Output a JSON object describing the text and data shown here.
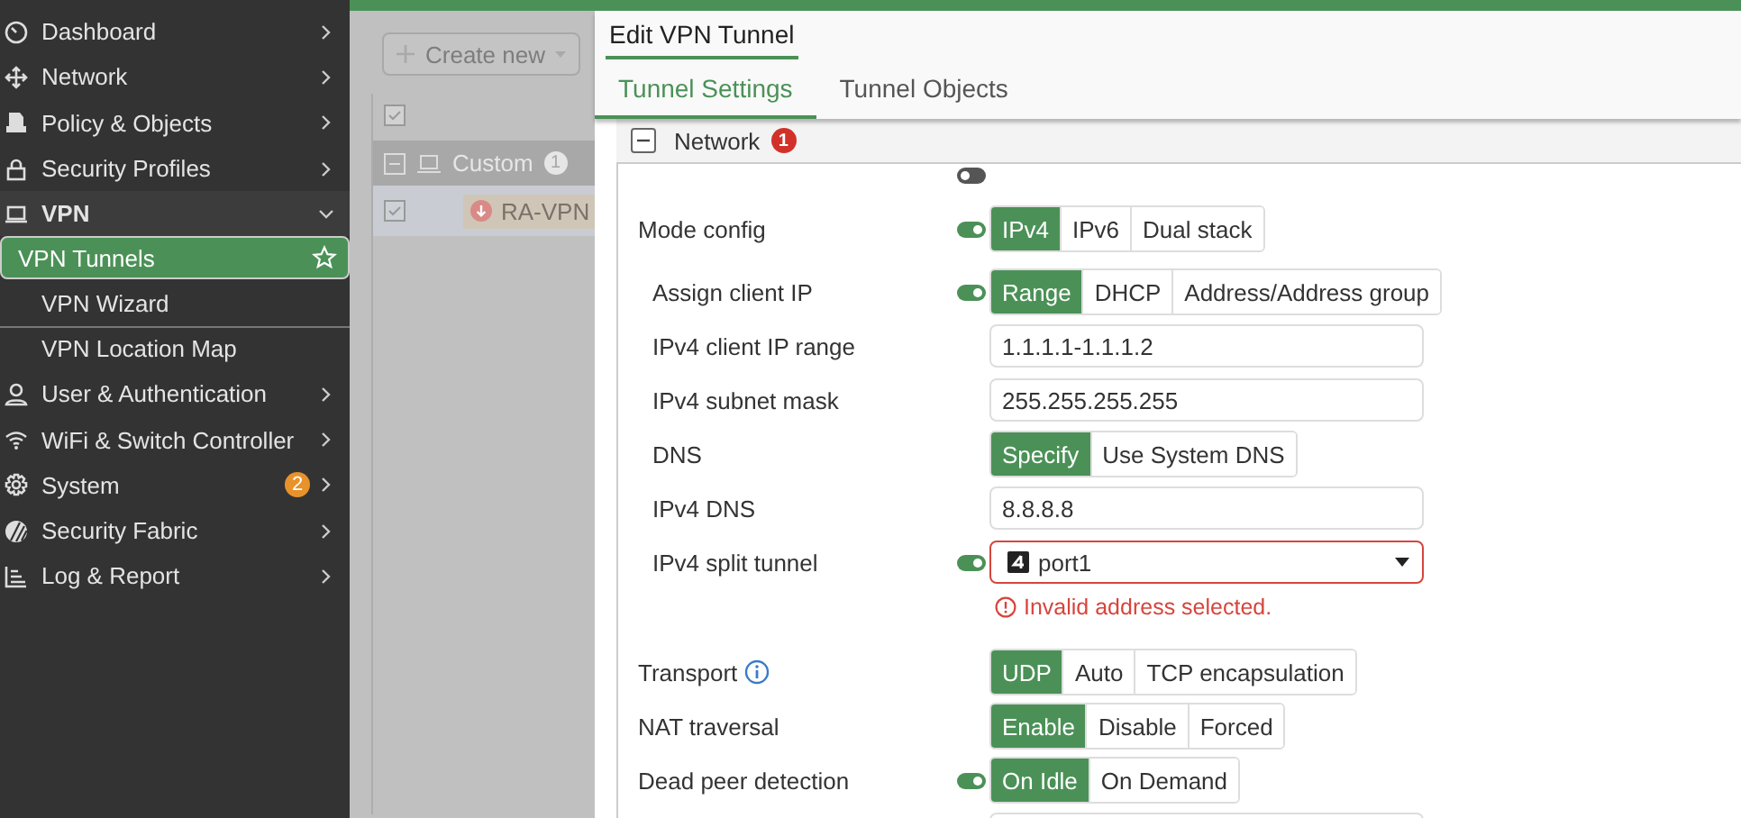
{
  "sidebar": {
    "items": [
      {
        "label": "Dashboard",
        "expanded": false,
        "selected": false
      },
      {
        "label": "Network",
        "expanded": false,
        "selected": false
      },
      {
        "label": "Policy & Objects",
        "expanded": false,
        "selected": false
      },
      {
        "label": "Security Profiles",
        "expanded": false,
        "selected": false
      },
      {
        "label": "VPN",
        "expanded": true,
        "selected": false,
        "children": [
          {
            "label": "VPN Tunnels",
            "selected": true,
            "favorite": true
          },
          {
            "label": "VPN Wizard",
            "selected": false
          },
          {
            "label": "VPN Location Map",
            "selected": false
          }
        ]
      },
      {
        "label": "User & Authentication",
        "expanded": false,
        "selected": false
      },
      {
        "label": "WiFi & Switch Controller",
        "expanded": false,
        "selected": false
      },
      {
        "label": "System",
        "expanded": false,
        "selected": false,
        "badge": "2"
      },
      {
        "label": "Security Fabric",
        "expanded": false,
        "selected": false
      },
      {
        "label": "Log & Report",
        "expanded": false,
        "selected": false
      }
    ]
  },
  "list_page": {
    "create_button": "Create new",
    "group": {
      "label": "Custom",
      "count": "1",
      "expanded": true
    },
    "rows": [
      {
        "name": "RA-VPN"
      }
    ]
  },
  "dialog": {
    "title": "Edit VPN Tunnel",
    "tabs": [
      {
        "label": "Tunnel Settings",
        "selected": true
      },
      {
        "label": "Tunnel Objects",
        "selected": false
      }
    ],
    "section": {
      "title": "Network",
      "badge": "1",
      "expanded": true
    },
    "rows": [
      {
        "kind": "toggle",
        "toggle": {
          "on": false
        }
      },
      {
        "kind": "segmented",
        "label": "Mode config",
        "toggle": {
          "on": true
        },
        "options": [
          {
            "label": "IPv4",
            "selected": true
          },
          {
            "label": "IPv6",
            "selected": false
          },
          {
            "label": "Dual stack",
            "selected": false
          }
        ],
        "children": [
          {
            "kind": "segmented",
            "label": "Assign client IP",
            "toggle": {
              "on": true
            },
            "options": [
              {
                "label": "Range",
                "selected": true
              },
              {
                "label": "DHCP",
                "selected": false
              },
              {
                "label": "Address/Address group",
                "selected": false
              }
            ]
          },
          {
            "kind": "input",
            "label": "IPv4 client IP range",
            "value": "1.1.1.1-1.1.1.2"
          },
          {
            "kind": "input",
            "label": "IPv4 subnet mask",
            "value": "255.255.255.255"
          },
          {
            "kind": "segmented",
            "label": "DNS",
            "options": [
              {
                "label": "Specify",
                "selected": true
              },
              {
                "label": "Use System DNS",
                "selected": false
              }
            ]
          },
          {
            "kind": "input",
            "label": "IPv4 DNS",
            "value": "8.8.8.8"
          },
          {
            "kind": "select",
            "label": "IPv4 split tunnel",
            "toggle": {
              "on": true
            },
            "value": "port1",
            "error": "Invalid address selected."
          }
        ]
      },
      {
        "kind": "segmented",
        "label": "Transport",
        "info": true,
        "options": [
          {
            "label": "UDP",
            "selected": true
          },
          {
            "label": "Auto",
            "selected": false
          },
          {
            "label": "TCP encapsulation",
            "selected": false
          }
        ]
      },
      {
        "kind": "segmented",
        "label": "NAT traversal",
        "options": [
          {
            "label": "Enable",
            "selected": true
          },
          {
            "label": "Disable",
            "selected": false
          },
          {
            "label": "Forced",
            "selected": false
          }
        ]
      },
      {
        "kind": "segmented",
        "label": "Dead peer detection",
        "toggle": {
          "on": true
        },
        "options": [
          {
            "label": "On Idle",
            "selected": true
          },
          {
            "label": "On Demand",
            "selected": false
          }
        ]
      },
      {
        "kind": "input"
      }
    ]
  }
}
